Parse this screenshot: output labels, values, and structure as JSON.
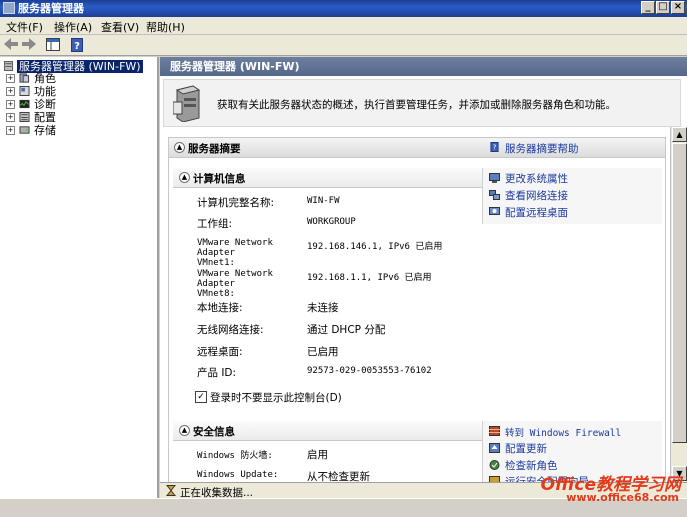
{
  "window": {
    "title": "服务器管理器",
    "controls": [
      "_",
      "□",
      "×"
    ]
  },
  "menubar": [
    "文件(F)",
    "操作(A)",
    "查看(V)",
    "帮助(H)"
  ],
  "tree": {
    "root": "服务器管理器 (WIN-FW)",
    "items": [
      "角色",
      "功能",
      "诊断",
      "配置",
      "存储"
    ]
  },
  "main": {
    "header": "服务器管理器 (WIN-FW)",
    "intro": "获取有关此服务器状态的概述，执行首要管理任务，并添加或删除服务器角色和功能。",
    "summary": {
      "title": "服务器摘要",
      "help_link": "服务器摘要帮助",
      "computer_info": {
        "title": "计算机信息",
        "rows": [
          {
            "label": "计算机完整名称:",
            "value": "WIN-FW"
          },
          {
            "label": "工作组:",
            "value": "WORKGROUP"
          },
          {
            "label": "VMware Network Adapter VMnet1:",
            "value": "192.168.146.1, IPv6 已启用"
          },
          {
            "label": "VMware Network Adapter VMnet8:",
            "value": "192.168.1.1, IPv6 已启用"
          },
          {
            "label": "本地连接:",
            "value": "未连接"
          },
          {
            "label": "无线网络连接:",
            "value": "通过 DHCP 分配"
          },
          {
            "label": "远程桌面:",
            "value": "已启用"
          },
          {
            "label": "产品 ID:",
            "value": "92573-029-0053553-76102"
          }
        ],
        "tasks": [
          "更改系统属性",
          "查看网络连接",
          "配置远程桌面"
        ],
        "checkbox_label": "登录时不要显示此控制台(D)",
        "checkbox_checked": true
      },
      "security_info": {
        "title": "安全信息",
        "rows": [
          {
            "label": "Windows 防火墙:",
            "value": "启用"
          },
          {
            "label": "Windows Update:",
            "value": "从不检查更新"
          }
        ],
        "tasks": [
          "转到 Windows Firewall",
          "配置更新",
          "检查新角色",
          "运行安全配置向导"
        ]
      }
    }
  },
  "status": "正在收集数据...",
  "watermark": {
    "brand": "Office教程学习网",
    "url": "www.office68.com"
  },
  "colors": {
    "titlebar": "#1c3f94",
    "link": "#1a3aa0",
    "header": "#5f7293"
  }
}
